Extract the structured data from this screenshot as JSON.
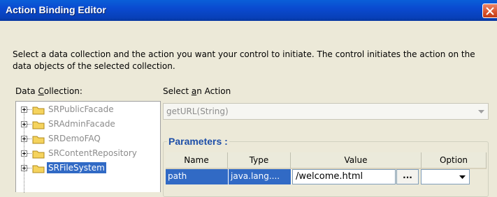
{
  "window": {
    "title": "Action Binding Editor"
  },
  "description": "Select a data collection and the action you want your control to initiate. The control initiates the action on the data objects of the selected collection.",
  "data_collection": {
    "label_pre": "Data ",
    "label_mnemonic": "C",
    "label_post": "ollection:",
    "items": [
      {
        "label": "SRPublicFacade",
        "selected": false
      },
      {
        "label": "SRAdminFacade",
        "selected": false
      },
      {
        "label": "SRDemoFAQ",
        "selected": false
      },
      {
        "label": "SRContentRepository",
        "selected": false
      },
      {
        "label": "SRFileSystem",
        "selected": true
      }
    ]
  },
  "action": {
    "label_pre": "Select ",
    "label_mnemonic": "a",
    "label_post": "n Action",
    "selected": "getURL(String)"
  },
  "parameters": {
    "title": "Parameters :",
    "columns": [
      "Name",
      "Type",
      "Value",
      "Option"
    ],
    "rows": [
      {
        "name": "path",
        "type": "java.lang....",
        "value": "/welcome.html",
        "ellipsis": "...",
        "option": ""
      }
    ]
  },
  "colors": {
    "selection": "#316ac5",
    "title_bar": "#0a4ad0",
    "group_title": "#1e4fa8"
  }
}
